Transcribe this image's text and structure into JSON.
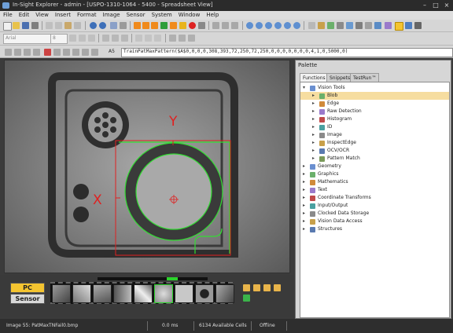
{
  "window": {
    "title": "In-Sight Explorer - admin - [USPO-1310-1064 - 5400 - Spreadsheet View]"
  },
  "menu": [
    "File",
    "Edit",
    "View",
    "Insert",
    "Format",
    "Image",
    "Sensor",
    "System",
    "Window",
    "Help"
  ],
  "toolbar": {
    "font_combo": "Arial",
    "size_combo": "8"
  },
  "formula_bar": {
    "cell_ref": "A5",
    "formula": "TrainPatMaxPattern($A$0,0,0,0,308,393,72,250,72,250,0,0,0,0,0,0,0,4,1,0,5000,0)"
  },
  "image_overlay": {
    "x_label": "X",
    "y_label": "Y"
  },
  "filmstrip": {
    "pc_label": "PC",
    "sensor_label": "Sensor"
  },
  "palette": {
    "title": "Palette",
    "tabs": [
      "Functions",
      "Snippets",
      "TestRun™"
    ],
    "tree": [
      {
        "label": "Vision Tools",
        "level": 0,
        "expanded": true,
        "icon": "vision-tools-icon"
      },
      {
        "label": "Blob",
        "level": 1,
        "selected": true,
        "icon": "blob-icon"
      },
      {
        "label": "Edge",
        "level": 1,
        "icon": "edge-icon"
      },
      {
        "label": "Raw Detection",
        "level": 1,
        "icon": "raw-detection-icon"
      },
      {
        "label": "Histogram",
        "level": 1,
        "icon": "histogram-icon"
      },
      {
        "label": "ID",
        "level": 1,
        "icon": "id-icon"
      },
      {
        "label": "Image",
        "level": 1,
        "icon": "image-icon"
      },
      {
        "label": "InspectEdge",
        "level": 1,
        "icon": "inspect-edge-icon"
      },
      {
        "label": "OCV/OCR",
        "level": 1,
        "icon": "ocv-ocr-icon"
      },
      {
        "label": "Pattern Match",
        "level": 1,
        "icon": "pattern-match-icon"
      },
      {
        "label": "Geometry",
        "level": 0,
        "icon": "geometry-icon"
      },
      {
        "label": "Graphics",
        "level": 0,
        "icon": "graphics-icon"
      },
      {
        "label": "Mathematics",
        "level": 0,
        "icon": "mathematics-icon"
      },
      {
        "label": "Text",
        "level": 0,
        "icon": "text-icon"
      },
      {
        "label": "Coordinate Transforms",
        "level": 0,
        "icon": "coordinate-transforms-icon"
      },
      {
        "label": "Input/Output",
        "level": 0,
        "icon": "input-output-icon"
      },
      {
        "label": "Clocked Data Storage",
        "level": 0,
        "icon": "clocked-data-storage-icon"
      },
      {
        "label": "Vision Data Access",
        "level": 0,
        "icon": "vision-data-access-icon"
      },
      {
        "label": "Structures",
        "level": 0,
        "icon": "structures-icon"
      }
    ]
  },
  "status": {
    "image": "Image 55: PatMaxTNFail0.bmp",
    "time": "0.0 ms",
    "cells": "6134 Available Cells",
    "mode": "Offline"
  },
  "colors": {
    "accent": "#f4c430",
    "overlay_red": "#e02020",
    "overlay_green": "#33dd33",
    "selection": "#f6dda0"
  }
}
